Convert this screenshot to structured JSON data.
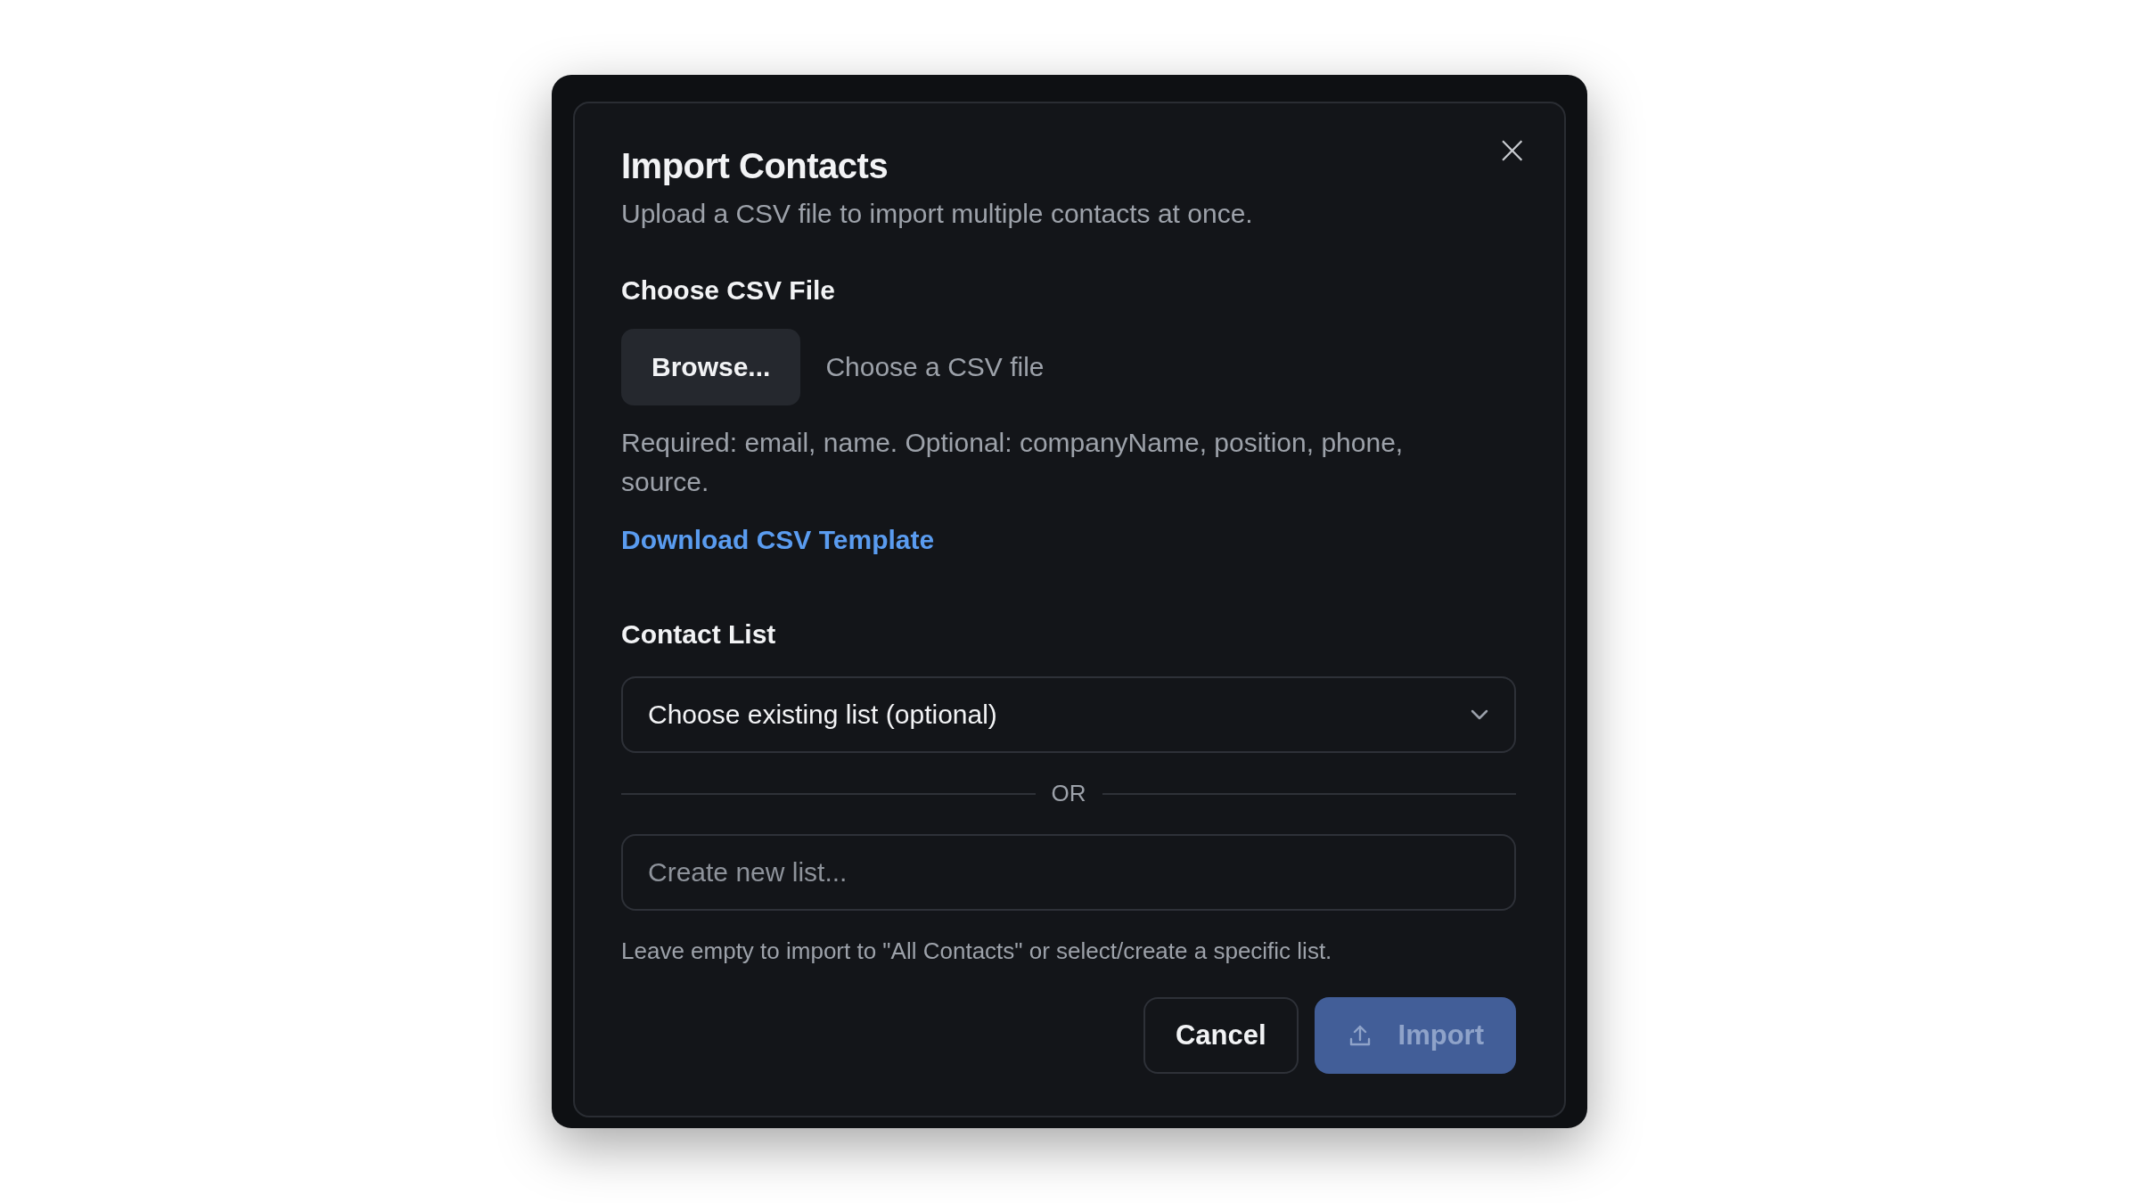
{
  "dialog": {
    "title": "Import Contacts",
    "subtitle": "Upload a CSV file to import multiple contacts at once.",
    "close_icon": "×"
  },
  "file_section": {
    "label": "Choose CSV File",
    "browse_button": "Browse...",
    "file_name_placeholder": "Choose a CSV file",
    "help": "Required: email, name. Optional: companyName, position, phone, source.",
    "template_link": "Download CSV Template"
  },
  "list_section": {
    "label": "Contact List",
    "select": {
      "value": "Choose existing list (optional)"
    },
    "divider_text": "OR",
    "new_list": {
      "placeholder": "Create new list..."
    },
    "hint": "Leave empty to import to \"All Contacts\" or select/create a specific list."
  },
  "buttons": [
    {
      "label": "Cancel",
      "kind": "secondary",
      "disabled": false
    },
    {
      "label": "Import",
      "kind": "primary",
      "disabled": true
    }
  ]
}
